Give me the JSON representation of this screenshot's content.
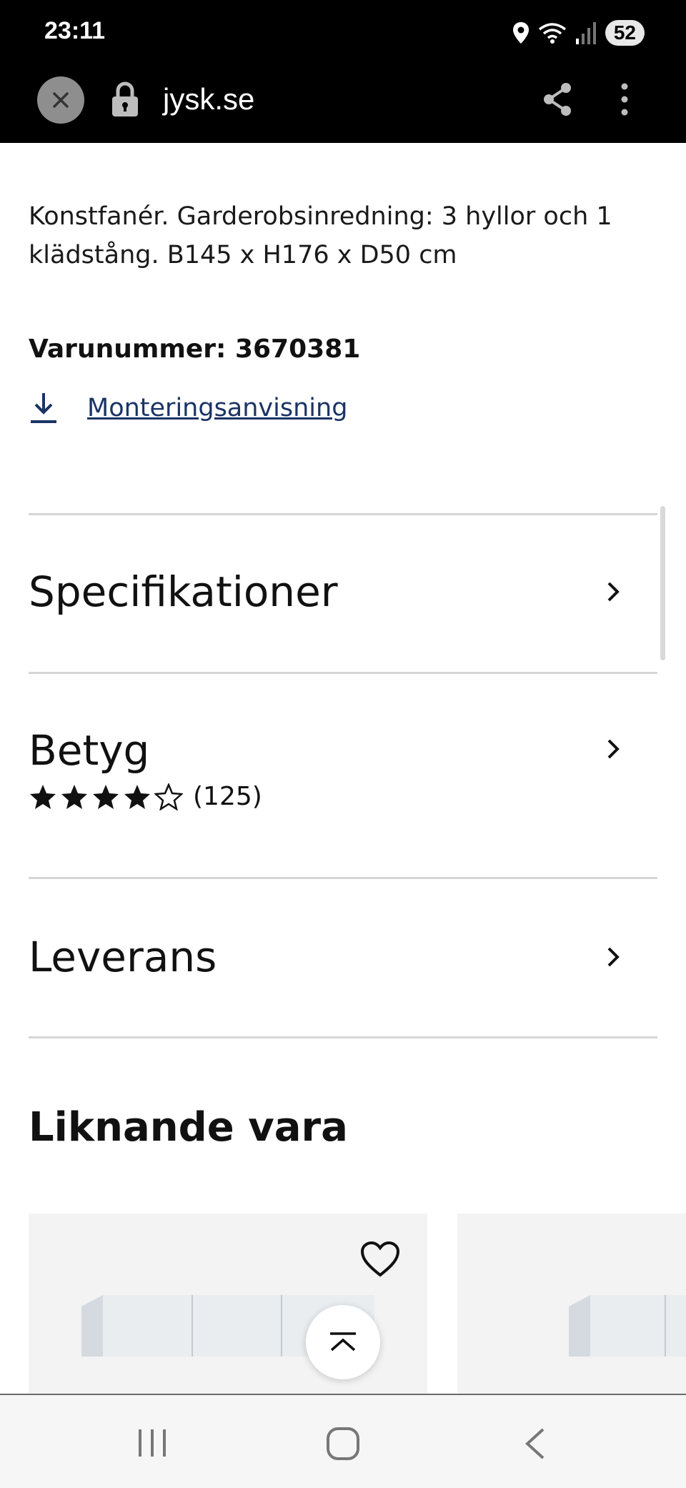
{
  "status_bar": {
    "time": "23:11",
    "battery": "52"
  },
  "browser": {
    "url": "jysk.se"
  },
  "product": {
    "description": "Konstfanér. Garderobsinredning: 3 hyllor och 1 klädstång. B145 x H176 x D50 cm",
    "sku": "Varunummer: 3670381",
    "manual_link": "Monteringsanvisning"
  },
  "accordion": {
    "specs": "Specifikationer",
    "rating_title": "Betyg",
    "rating_count": "(125)",
    "rating_stars": 4,
    "rating_max": 5,
    "delivery": "Leverans"
  },
  "similar": {
    "title": "Liknande vara"
  },
  "colors": {
    "link": "#1b3466",
    "card_bg": "#f3f3f3",
    "divider": "#d6d6d6"
  },
  "icons": [
    "close-icon",
    "lock-icon",
    "share-icon",
    "more-icon",
    "download-icon",
    "chevron-right-icon",
    "star-icon",
    "heart-icon",
    "arrow-up-icon",
    "recents-icon",
    "home-icon",
    "back-icon"
  ]
}
